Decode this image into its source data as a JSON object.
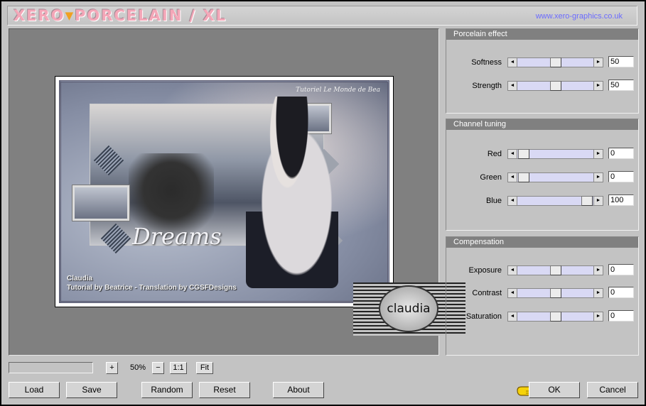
{
  "app": {
    "logo_text": "XERO",
    "logo_sep": "▼",
    "logo_text2": "PORCELAIN / XL",
    "site_link": "www.xero-graphics.co.uk"
  },
  "preview": {
    "overlay_top_right": "Tutoriel Le Monde de Bea",
    "title_word": "Dreams",
    "credit_line1": "Claudia",
    "credit_line2": "Tutorial by Beatrice - Translation by CGSFDesigns",
    "stamp_text": "claudia"
  },
  "panels": {
    "porcelain": {
      "title": "Porcelain effect",
      "rows": [
        {
          "label": "Softness",
          "value": "50",
          "level": 0.5
        },
        {
          "label": "Strength",
          "value": "50",
          "level": 0.5
        }
      ]
    },
    "channel": {
      "title": "Channel tuning",
      "rows": [
        {
          "label": "Red",
          "value": "0",
          "level": 0
        },
        {
          "label": "Green",
          "value": "0",
          "level": 0
        },
        {
          "label": "Blue",
          "value": "100",
          "level": 1
        }
      ]
    },
    "compensation": {
      "title": "Compensation",
      "rows": [
        {
          "label": "Exposure",
          "value": "0",
          "level": 0.5
        },
        {
          "label": "Contrast",
          "value": "0",
          "level": 0.5
        },
        {
          "label": "Saturation",
          "value": "0",
          "level": 0.5
        }
      ]
    }
  },
  "zoom": {
    "plus": "+",
    "value": "50%",
    "minus": "−",
    "one_to_one": "1:1",
    "fit": "Fit"
  },
  "buttons": {
    "load": "Load",
    "save": "Save",
    "random": "Random",
    "reset": "Reset",
    "about": "About",
    "ok": "OK",
    "cancel": "Cancel"
  },
  "colors": {
    "window_bg": "#c3c3c3",
    "panel_title_bg": "#808080",
    "slider_track": "#d9d9f4",
    "link": "#6b6bff",
    "logo": "#f4a7b8"
  }
}
